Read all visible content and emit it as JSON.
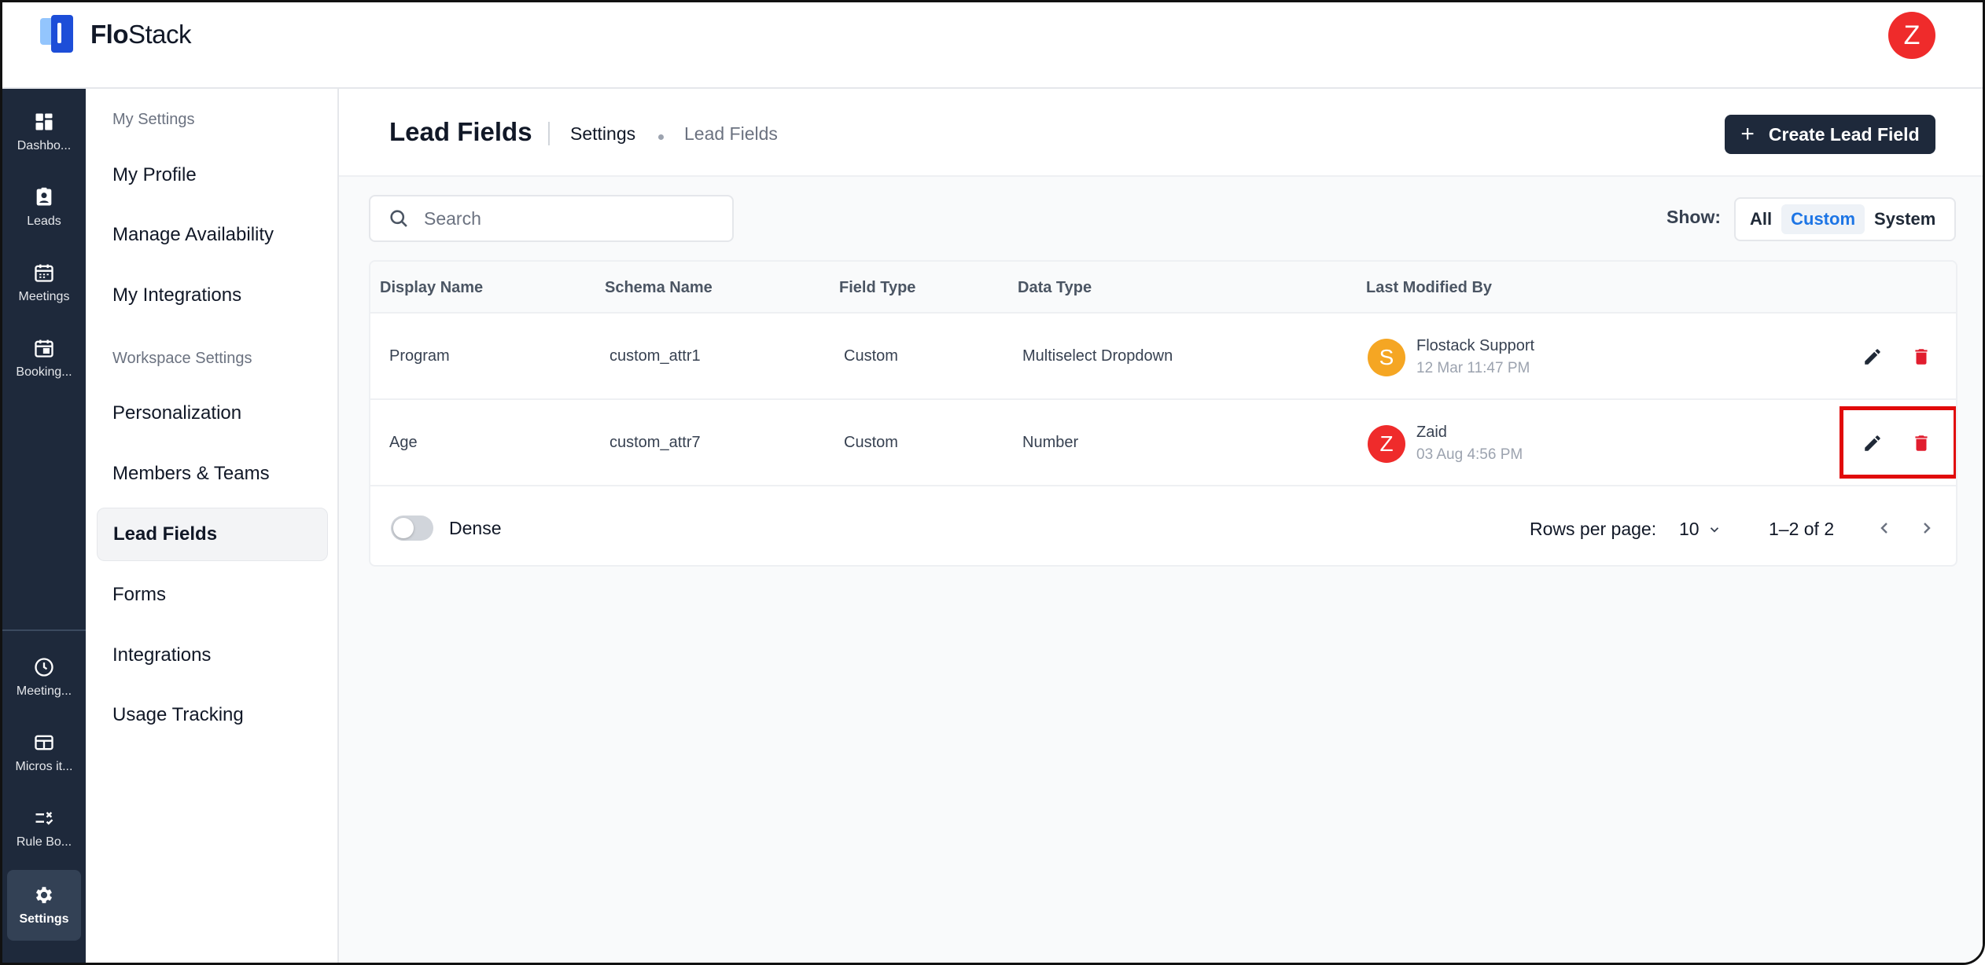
{
  "app": {
    "brand_bold": "Flo",
    "brand_light": "Stack",
    "user_initial": "Z"
  },
  "rail": {
    "top": [
      {
        "label": "Dashbo...",
        "icon": "dashboard-icon"
      },
      {
        "label": "Leads",
        "icon": "leads-icon"
      },
      {
        "label": "Meetings",
        "icon": "calendar-icon"
      },
      {
        "label": "Booking...",
        "icon": "booking-icon"
      }
    ],
    "bottom": [
      {
        "label": "Meeting...",
        "icon": "clock-icon"
      },
      {
        "label": "Micros it...",
        "icon": "microsite-icon"
      },
      {
        "label": "Rule Bo...",
        "icon": "rule-icon"
      },
      {
        "label": "Settings",
        "icon": "gear-icon"
      }
    ]
  },
  "sidebar": {
    "my_settings": "My Settings",
    "workspace_settings": "Workspace Settings",
    "items": [
      "My Profile",
      "Manage Availability",
      "My Integrations",
      "Personalization",
      "Members & Teams",
      "Lead Fields",
      "Forms",
      "Integrations",
      "Usage Tracking"
    ]
  },
  "page": {
    "title": "Lead Fields",
    "breadcrumb": [
      "Settings",
      "Lead Fields"
    ],
    "create_button": "Create Lead Field"
  },
  "search": {
    "placeholder": "Search"
  },
  "filter": {
    "label": "Show:",
    "options": [
      "All",
      "Custom",
      "System"
    ],
    "selected": "Custom"
  },
  "table": {
    "columns": [
      "Display Name",
      "Schema Name",
      "Field Type",
      "Data Type",
      "Last Modified By"
    ],
    "rows": [
      {
        "display_name": "Program",
        "schema_name": "custom_attr1",
        "field_type": "Custom",
        "data_type": "Multiselect Dropdown",
        "modified_by": "Flostack Support",
        "modified_initial": "S",
        "modified_at": "12 Mar 11:47 PM",
        "avatar_color": "#f5a623"
      },
      {
        "display_name": "Age",
        "schema_name": "custom_attr7",
        "field_type": "Custom",
        "data_type": "Number",
        "modified_by": "Zaid",
        "modified_initial": "Z",
        "modified_at": "03 Aug 4:56 PM",
        "avatar_color": "#ef2b2b"
      }
    ]
  },
  "footer": {
    "dense_label": "Dense",
    "rows_per_page_label": "Rows per page:",
    "rows_per_page": "10",
    "range": "1–2 of 2"
  },
  "colors": {
    "rail_bg": "#1e293b",
    "accent": "#1d75e5",
    "danger": "#e11d2e",
    "highlight": "#e10a0a"
  }
}
